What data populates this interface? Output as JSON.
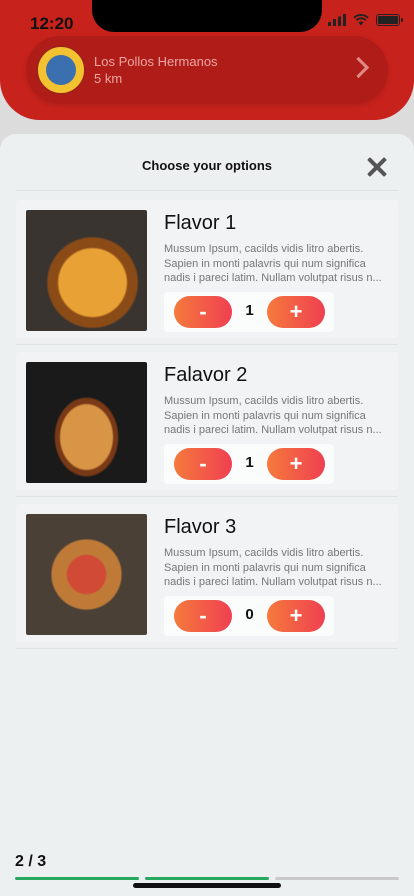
{
  "status": {
    "time": "12:20"
  },
  "store": {
    "name": "Los Pollos Hermanos",
    "distance": "5 km",
    "logo_icon": "los-pollos-logo"
  },
  "sheet": {
    "title": "Choose your options"
  },
  "items": [
    {
      "title": "Flavor 1",
      "desc": [
        "Mussum Ipsum, cacilds vidis litro abertis.",
        "Sapien in monti palavris qui num significa",
        "nadis i pareci latim. Nullam volutpat risus n..."
      ],
      "minus": "-",
      "plus": "+",
      "qty": "1"
    },
    {
      "title": "Falavor 2",
      "desc": [
        "Mussum Ipsum, cacilds vidis litro abertis.",
        "Sapien in monti palavris qui num significa",
        "nadis i pareci latim. Nullam volutpat risus n..."
      ],
      "minus": "-",
      "plus": "+",
      "qty": "1"
    },
    {
      "title": "Flavor 3",
      "desc": [
        "Mussum Ipsum, cacilds vidis litro abertis.",
        "Sapien in monti palavris qui num significa",
        "nadis i pareci latim. Nullam volutpat risus n..."
      ],
      "minus": "-",
      "plus": "+",
      "qty": "0"
    }
  ],
  "progress": {
    "label": "2 / 3",
    "steps_done": 2,
    "steps_total": 3,
    "done_color": "#27a85f",
    "todo_color": "#c8c8c8"
  },
  "colors": {
    "accent_start": "#f67a3c",
    "accent_end": "#ef3f52",
    "brand": "#c8221c"
  }
}
